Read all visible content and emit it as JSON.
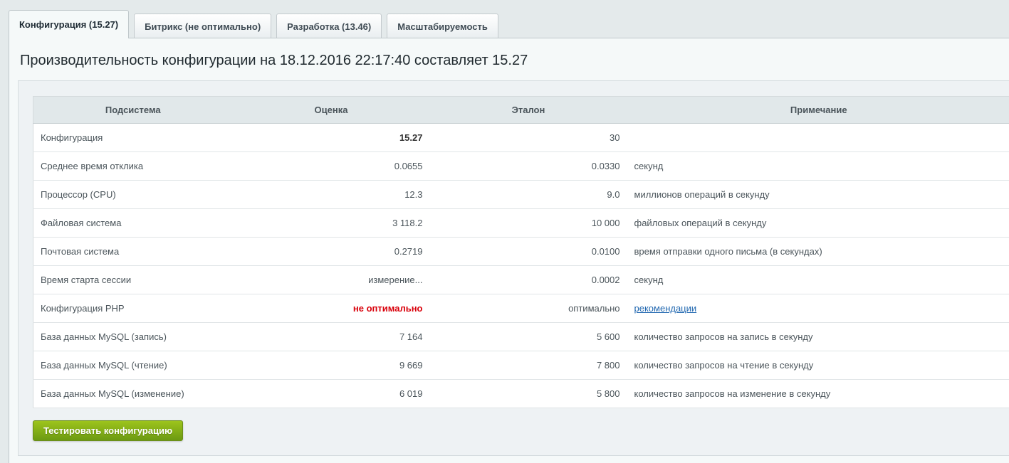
{
  "tabs": [
    {
      "label": "Конфигурация (15.27)",
      "active": true
    },
    {
      "label": "Битрикс (не оптимально)",
      "active": false
    },
    {
      "label": "Разработка (13.46)",
      "active": false
    },
    {
      "label": "Масштабируемость",
      "active": false
    }
  ],
  "page_title": "Производительность конфигурации на 18.12.2016 22:17:40 составляет 15.27",
  "table": {
    "headers": [
      "Подсистема",
      "Оценка",
      "Эталон",
      "Примечание"
    ],
    "rows": [
      {
        "name": "Конфигурация",
        "score": "15.27",
        "reference": "30",
        "note": ""
      },
      {
        "name": "Среднее время отклика",
        "score": "0.0655",
        "reference": "0.0330",
        "note": "секунд"
      },
      {
        "name": "Процессор (CPU)",
        "score": "12.3",
        "reference": "9.0",
        "note": "миллионов операций в секунду"
      },
      {
        "name": "Файловая система",
        "score": "3 118.2",
        "reference": "10 000",
        "note": "файловых операций в секунду"
      },
      {
        "name": "Почтовая система",
        "score": "0.2719",
        "reference": "0.0100",
        "note": "время отправки одного письма (в секундах)"
      },
      {
        "name": "Время старта сессии",
        "score": "измерение...",
        "reference": "0.0002",
        "note": "секунд"
      },
      {
        "name": "Конфигурация PHP",
        "score": "не оптимально",
        "reference": "оптимально",
        "note": "рекомендации"
      },
      {
        "name": "База данных MySQL (запись)",
        "score": "7 164",
        "reference": "5 600",
        "note": "количество запросов на запись в секунду"
      },
      {
        "name": "База данных MySQL (чтение)",
        "score": "9 669",
        "reference": "7 800",
        "note": "количество запросов на чтение в секунду"
      },
      {
        "name": "База данных MySQL (изменение)",
        "score": "6 019",
        "reference": "5 800",
        "note": "количество запросов на изменение в секунду"
      }
    ]
  },
  "test_button_label": "Тестировать конфигурацию",
  "colors": {
    "warning_red": "#d9000a",
    "link_blue": "#2067b0",
    "button_green": "#7ba814"
  }
}
